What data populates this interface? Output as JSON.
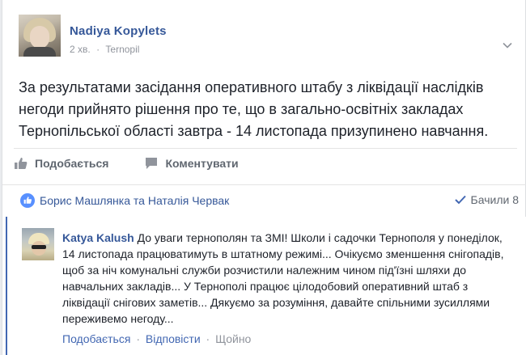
{
  "post": {
    "author": "Nadiya Kopylets",
    "time": "2 хв.",
    "separator": "·",
    "location": "Ternopil",
    "text": "За результатами засідання оперативного штабу з ліквідації наслідків негоди прийнято рішення про те, що в загально-освітніх закладах Тернопільської області завтра - 14 листопада призупинено навчання."
  },
  "actions": {
    "like_label": "Подобається",
    "comment_label": "Коментувати"
  },
  "reactions": {
    "names": "Борис Машлянка та Наталія Червак",
    "seen_label": "Бачили 8"
  },
  "comment": {
    "author": "Katya Kalush",
    "text": "До уваги тернополян та ЗМІ! Школи і садочки Тернополя у понеділок, 14 листопада працюватимуть в штатному режимі... Очікуємо зменшення снігопадів, щоб за ніч комунальні служби розчистили належним чином під'їзні шляхи до навчальних закладів... У Тернополі працює цілодобовий оперативний штаб з ліквідації снігових заметів... Дякуємо за розуміння, давайте спільними зусиллями переживемо негоду...",
    "like_label": "Подобається",
    "reply_label": "Відповісти",
    "time": "Щойно",
    "separator": "·"
  },
  "colors": {
    "link": "#365899",
    "meta": "#90949c",
    "like_badge": "#5890ff"
  }
}
